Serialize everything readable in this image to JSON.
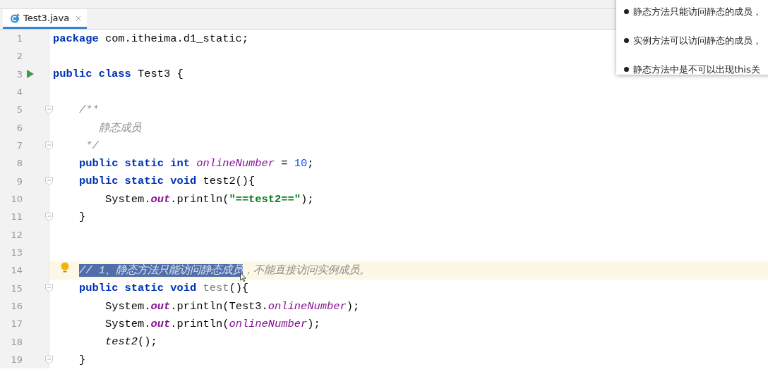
{
  "editor_tabs": [
    {
      "label": "Test3.java",
      "selected": true
    }
  ],
  "code_lines": [
    {
      "number": "1",
      "kind": "top",
      "run": false,
      "fold": false,
      "bulb": false,
      "current": false,
      "tokens": [
        {
          "kind": "keyword",
          "text": "package"
        },
        {
          "kind": "plain",
          "text": " com.itheima.d1_static;"
        }
      ]
    },
    {
      "number": "2",
      "run": false,
      "fold": false,
      "bulb": false,
      "current": false
    },
    {
      "number": "3",
      "kind": "top",
      "run": true,
      "fold": false,
      "bulb": false,
      "current": false,
      "tokens": [
        {
          "kind": "keyword",
          "text": "public class"
        },
        {
          "kind": "plain",
          "text": " Test3 {"
        }
      ]
    },
    {
      "number": "4",
      "run": false,
      "fold": false,
      "bulb": false,
      "current": false
    },
    {
      "number": "5",
      "kind": "member",
      "run": false,
      "fold": true,
      "bulb": false,
      "current": false,
      "tokens": [
        {
          "kind": "comment",
          "text": "/**"
        }
      ]
    },
    {
      "number": "6",
      "kind": "doc_body",
      "run": false,
      "fold": false,
      "bulb": false,
      "current": false,
      "tokens": [
        {
          "kind": "comment",
          "text": "静态成员"
        }
      ]
    },
    {
      "number": "7",
      "kind": "doc_end",
      "run": false,
      "fold": true,
      "bulb": false,
      "current": false,
      "tokens": [
        {
          "kind": "comment",
          "text": "*/"
        }
      ]
    },
    {
      "number": "8",
      "kind": "member",
      "run": false,
      "fold": false,
      "bulb": false,
      "current": false,
      "tokens": [
        {
          "kind": "keyword",
          "text": "public static int"
        },
        {
          "kind": "field",
          "text": " onlineNumber"
        },
        {
          "kind": "plain",
          "text": " = "
        },
        {
          "kind": "number",
          "text": "10"
        },
        {
          "kind": "plain",
          "text": ";"
        }
      ]
    },
    {
      "number": "9",
      "kind": "member",
      "run": false,
      "fold": true,
      "bulb": false,
      "current": false,
      "tokens": [
        {
          "kind": "keyword",
          "text": "public static void"
        },
        {
          "kind": "plain",
          "text": " test2(){"
        }
      ]
    },
    {
      "number": "10",
      "kind": "body",
      "run": false,
      "fold": false,
      "bulb": false,
      "current": false,
      "tokens": [
        {
          "kind": "plain",
          "text": "System."
        },
        {
          "kind": "static_field",
          "text": "out"
        },
        {
          "kind": "plain",
          "text": ".println("
        },
        {
          "kind": "string",
          "text": "\"==test2==\""
        },
        {
          "kind": "plain",
          "text": ");"
        }
      ]
    },
    {
      "number": "11",
      "kind": "member",
      "run": false,
      "fold": true,
      "bulb": false,
      "current": false,
      "tokens": [
        {
          "kind": "plain",
          "text": "}"
        }
      ]
    },
    {
      "number": "12",
      "run": false,
      "fold": false,
      "bulb": false,
      "current": false
    },
    {
      "number": "13",
      "run": false,
      "fold": false,
      "bulb": false,
      "current": false
    },
    {
      "number": "14",
      "kind": "member",
      "run": false,
      "fold": false,
      "bulb": true,
      "current": true,
      "tokens": [
        {
          "kind": "comment",
          "text": "// 1、静态方法只能访问静态成员",
          "selected": true
        },
        {
          "kind": "comment",
          "text": "，不能直接访问实例成员。",
          "selected": false
        }
      ]
    },
    {
      "number": "15",
      "kind": "member",
      "run": false,
      "fold": true,
      "bulb": false,
      "current": false,
      "tokens": [
        {
          "kind": "keyword",
          "text": "public static void"
        },
        {
          "kind": "unused",
          "text": " test"
        },
        {
          "kind": "plain",
          "text": "(){"
        }
      ]
    },
    {
      "number": "16",
      "kind": "body",
      "run": false,
      "fold": false,
      "bulb": false,
      "current": false,
      "tokens": [
        {
          "kind": "plain",
          "text": "System."
        },
        {
          "kind": "static_field",
          "text": "out"
        },
        {
          "kind": "plain",
          "text": ".println(Test3."
        },
        {
          "kind": "field",
          "text": "onlineNumber"
        },
        {
          "kind": "plain",
          "text": ");"
        }
      ]
    },
    {
      "number": "17",
      "kind": "body",
      "run": false,
      "fold": false,
      "bulb": false,
      "current": false,
      "tokens": [
        {
          "kind": "plain",
          "text": "System."
        },
        {
          "kind": "static_field",
          "text": "out"
        },
        {
          "kind": "plain",
          "text": ".println("
        },
        {
          "kind": "field",
          "text": "onlineNumber"
        },
        {
          "kind": "plain",
          "text": ");"
        }
      ]
    },
    {
      "number": "18",
      "kind": "body",
      "run": false,
      "fold": false,
      "bulb": false,
      "current": false,
      "tokens": [
        {
          "kind": "static_call",
          "text": "test2"
        },
        {
          "kind": "plain",
          "text": "();"
        }
      ]
    },
    {
      "number": "19",
      "kind": "member",
      "run": false,
      "fold": true,
      "bulb": false,
      "current": false,
      "tokens": [
        {
          "kind": "plain",
          "text": "}"
        }
      ]
    }
  ],
  "notes_popup": {
    "items": [
      "静态方法只能访问静态的成员，",
      "实例方法可以访问静态的成员，",
      "静态方法中是不可以出现this关"
    ]
  }
}
